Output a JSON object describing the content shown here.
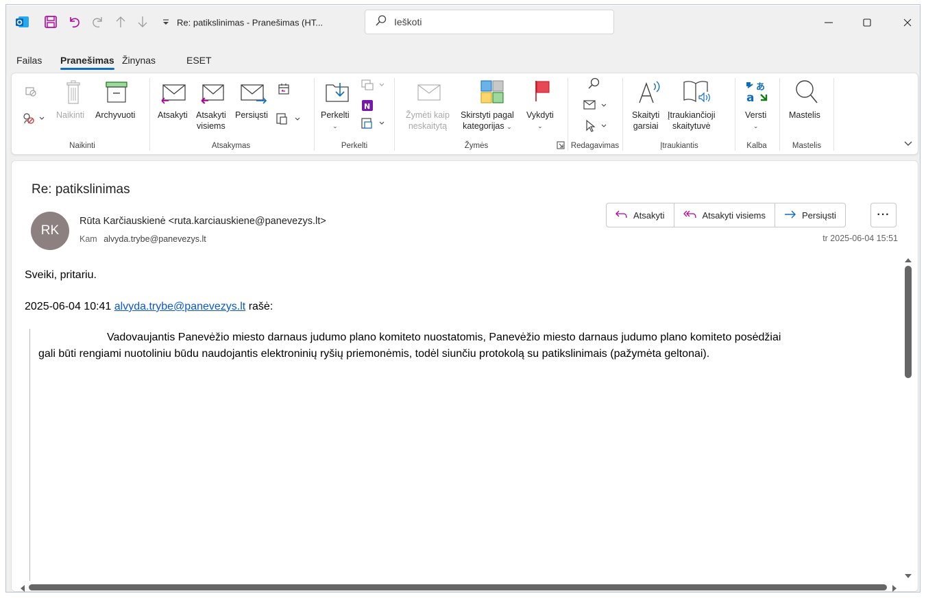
{
  "titlebar": {
    "document_title": "Re: patikslinimas  -  Pranešimas (HT...",
    "search_placeholder": "Ieškoti"
  },
  "menu": {
    "tabs": [
      "Failas",
      "Pranešimas",
      "Žinynas",
      "ESET"
    ],
    "active_tab": "Pranešimas"
  },
  "ribbon": {
    "groups": {
      "naikinti": "Naikinti",
      "atsakymas": "Atsakymas",
      "perkelti": "Perkelti",
      "zymes": "Žymės",
      "redagavimas": "Redagavimas",
      "itraukiantis": "Įtraukiantis",
      "kalba": "Kalba",
      "mastelis": "Mastelis"
    },
    "buttons": {
      "naikinti": "Naikinti",
      "archyvuoti": "Archyvuoti",
      "atsakyti": "Atsakyti",
      "atsakyti_visiems_1": "Atsakyti",
      "atsakyti_visiems_2": "visiems",
      "persiusti": "Persiųsti",
      "perkelti": "Perkelti",
      "zymeti_1": "Žymėti kaip",
      "zymeti_2": "neskaitytą",
      "skirstyti_1": "Skirstyti pagal",
      "skirstyti_2": "kategorijas",
      "vykdyti": "Vykdyti",
      "skaityti_1": "Skaityti",
      "skaityti_2": "garsiai",
      "itrauk_1": "Įtraukiančioji",
      "itrauk_2": "skaitytuvė",
      "versti": "Versti",
      "mastelis": "Mastelis"
    }
  },
  "message": {
    "subject": "Re: patikslinimas",
    "avatar_initials": "RK",
    "from": "Rūta Karčiauskienė <ruta.karciauskiene@panevezys.lt>",
    "to_label": "Kam",
    "to": "alvyda.trybe@panevezys.lt",
    "datetime": "tr 2025-06-04 15:51",
    "actions": {
      "reply": "Atsakyti",
      "reply_all": "Atsakyti visiems",
      "forward": "Persiųsti",
      "more": "···"
    },
    "body": {
      "greeting": "Sveiki, pritariu.",
      "quote_header_prefix": "2025-06-04 10:41",
      "quote_header_link": "alvyda.trybe@panevezys.lt",
      "quote_header_suffix": "rašė:",
      "quote_line1": "Vadovaujantis Panevėžio miesto darnaus judumo plano komiteto nuostatomis, Panevėžio miesto darnaus judumo plano komiteto posėdžiai",
      "quote_line2": "gali būti rengiami nuotoliniu būdu naudojantis elektroninių ryšių priemonėmis, todėl siunčiu protokolą su patikslinimais (pažymėta geltonai)."
    }
  },
  "colors": {
    "accent": "#0f6cbd",
    "link": "#0b57d0",
    "avatar": "#8c8180",
    "flag": "#e74856"
  }
}
